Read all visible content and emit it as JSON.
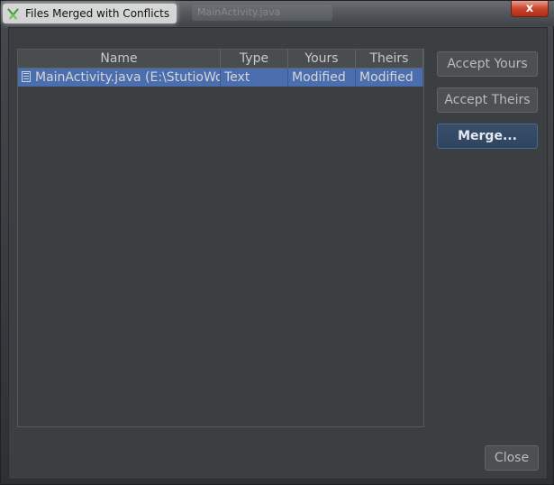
{
  "window": {
    "title": "Files Merged with Conflicts",
    "background_title": "MainActivity.java",
    "close_glyph": "x"
  },
  "table": {
    "headers": {
      "name": "Name",
      "type": "Type",
      "yours": "Yours",
      "theirs": "Theirs"
    },
    "rows": [
      {
        "name": "MainActivity.java (E:\\StutioWo",
        "type": "Text",
        "yours": "Modified",
        "theirs": "Modified",
        "icon": "file-icon",
        "selected": true
      }
    ]
  },
  "buttons": {
    "accept_yours": "Accept Yours",
    "accept_theirs": "Accept Theirs",
    "merge": "Merge...",
    "close": "Close"
  },
  "colors": {
    "dialog_bg": "#3c3f41",
    "selection": "#4b6eaf",
    "default_button": "#2f4460"
  }
}
